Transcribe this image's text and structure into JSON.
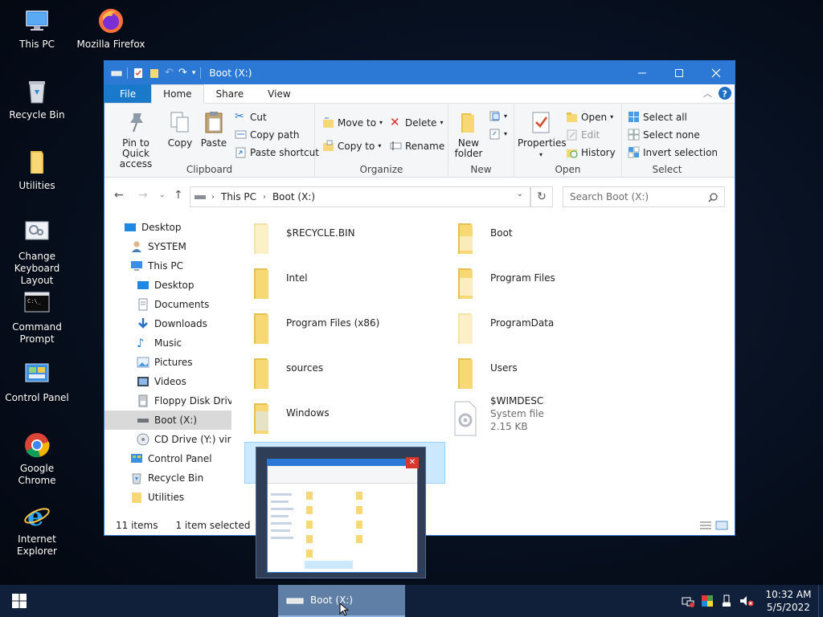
{
  "desktop": {
    "icons": [
      {
        "label": "This PC"
      },
      {
        "label": "Mozilla Firefox"
      },
      {
        "label": "Recycle Bin"
      },
      {
        "label": "Utilities"
      },
      {
        "label": "Change Keyboard Layout"
      },
      {
        "label": "Command Prompt"
      },
      {
        "label": "Control Panel"
      },
      {
        "label": "Google Chrome"
      },
      {
        "label": "Internet Explorer"
      }
    ]
  },
  "window": {
    "title": "Boot (X:)",
    "tabs": [
      "File",
      "Home",
      "Share",
      "View"
    ],
    "ribbon": {
      "clipboard": {
        "name": "Clipboard",
        "pin": "Pin to Quick access",
        "copy": "Copy",
        "paste": "Paste",
        "cut": "Cut",
        "copy_path": "Copy path",
        "paste_shortcut": "Paste shortcut"
      },
      "organize": {
        "name": "Organize",
        "move_to": "Move to",
        "copy_to": "Copy to",
        "delete": "Delete",
        "rename": "Rename"
      },
      "new": {
        "name": "New",
        "new_folder": "New folder"
      },
      "open": {
        "name": "Open",
        "properties": "Properties",
        "open": "Open",
        "edit": "Edit",
        "history": "History"
      },
      "select": {
        "name": "Select",
        "select_all": "Select all",
        "select_none": "Select none",
        "invert": "Invert selection"
      }
    },
    "address": {
      "crumbs": [
        "This PC",
        "Boot (X:)"
      ],
      "search_placeholder": "Search Boot (X:)"
    },
    "nav": [
      {
        "label": "Desktop"
      },
      {
        "label": "SYSTEM"
      },
      {
        "label": "This PC"
      },
      {
        "label": "Desktop"
      },
      {
        "label": "Documents"
      },
      {
        "label": "Downloads"
      },
      {
        "label": "Music"
      },
      {
        "label": "Pictures"
      },
      {
        "label": "Videos"
      },
      {
        "label": "Floppy Disk Drive"
      },
      {
        "label": "Boot (X:)"
      },
      {
        "label": "CD Drive (Y:) virtic"
      },
      {
        "label": "Control Panel"
      },
      {
        "label": "Recycle Bin"
      },
      {
        "label": "Utilities"
      }
    ],
    "files": [
      {
        "name": "$RECYCLE.BIN"
      },
      {
        "name": "Boot"
      },
      {
        "name": "Intel"
      },
      {
        "name": "Program Files"
      },
      {
        "name": "Program Files (x86)"
      },
      {
        "name": "ProgramData"
      },
      {
        "name": "sources"
      },
      {
        "name": "Users"
      },
      {
        "name": "Windows"
      },
      {
        "name": "$WIMDESC",
        "type": "System file",
        "size": "2.15 KB"
      }
    ],
    "status": {
      "count": "11 items",
      "selected": "1 item selected"
    }
  },
  "taskbar": {
    "item": "Boot (X:)",
    "time": "10:32 AM",
    "date": "5/5/2022"
  },
  "colors": {
    "titlebar": "#2b79d5",
    "file_tab": "#1979ca",
    "taskbar": "#10203b",
    "selection": "#cce8ff"
  }
}
